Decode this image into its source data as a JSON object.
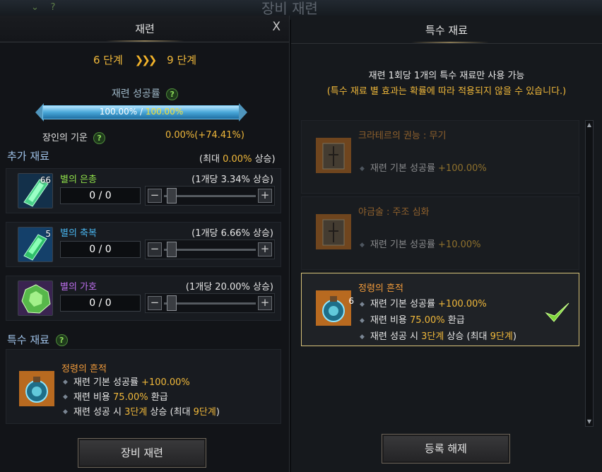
{
  "background": {
    "window_title": "장비 재련",
    "icons": [
      "chevron-down-icon",
      "help-icon"
    ]
  },
  "left": {
    "title": "재련",
    "close_label": "X",
    "stage": {
      "from": "6 단계",
      "arrows": "❯❯❯",
      "to": "9 단계"
    },
    "success_rate_label": "재련 성공률",
    "help": "?",
    "bar": {
      "current": "100.00%",
      "sep": " / ",
      "max": "100.00%",
      "fill_percent": 100
    },
    "artisan": {
      "label": "장인의 기운",
      "value": "0.00%(+74.41%)"
    },
    "extra_title": "추가 재료",
    "extra_max": {
      "prefix": "(최대 ",
      "value": "0.00%",
      "suffix": " 상승)"
    },
    "materials": [
      {
        "name": "별의 은총",
        "color": "#8fe04a",
        "count": "66",
        "per": "(1개당 3.34% 상승)",
        "qty": "0   /   0",
        "icon": "green-crystal-icon"
      },
      {
        "name": "별의 축복",
        "color": "#49b6f0",
        "count": "5",
        "per": "(1개당 6.66% 상승)",
        "qty": "0   /   0",
        "icon": "blue-crystal-icon"
      },
      {
        "name": "별의 가호",
        "color": "#c070f0",
        "count": "",
        "per": "(1개당 20.00% 상승)",
        "qty": "0   /   0",
        "icon": "green-gem-icon"
      }
    ],
    "minus": "−",
    "plus": "+",
    "special_title": "특수 재료",
    "special": {
      "name": "정령의 흔적",
      "lines": [
        {
          "a": "재련 기본 성공률 ",
          "b": "+100.00%",
          "c": ""
        },
        {
          "a": "재련 비용 ",
          "b": "75.00%",
          "c": " 환급"
        },
        {
          "a": "재련 성공 시 ",
          "b": "3단계",
          "c": " 상승 (최대 ",
          "d": "9단계",
          "e": ")"
        }
      ]
    },
    "refine_button": "장비 재련"
  },
  "right": {
    "title": "특수 재료",
    "notice1": "재련 1회당 1개의 특수 재료만 사용 가능",
    "notice2": "(특수 재료 별 효과는 확률에 따라 적용되지 않을 수 있습니다.)",
    "cards": [
      {
        "name": "크라테르의 권능 : 무기",
        "line_a": "재련 기본 성공률 ",
        "line_b": "+100.00%"
      },
      {
        "name": "야금술 : 주조 심화",
        "line_a": "재련 기본 성공률 ",
        "line_b": "+10.00%"
      }
    ],
    "selected": {
      "name": "정령의 흔적",
      "count": "6",
      "lines": [
        {
          "a": "재련 기본 성공률 ",
          "b": "+100.00%",
          "c": ""
        },
        {
          "a": "재련 비용 ",
          "b": "75.00%",
          "c": " 환급"
        },
        {
          "a": "재련 성공 시 ",
          "b": "3단계",
          "c": " 상승 (최대 ",
          "d": "9단계",
          "e": ")"
        }
      ]
    },
    "unregister_button": "등록 해제",
    "bullet": "◆",
    "scroll_up": "▲",
    "scroll_down": "▼"
  }
}
